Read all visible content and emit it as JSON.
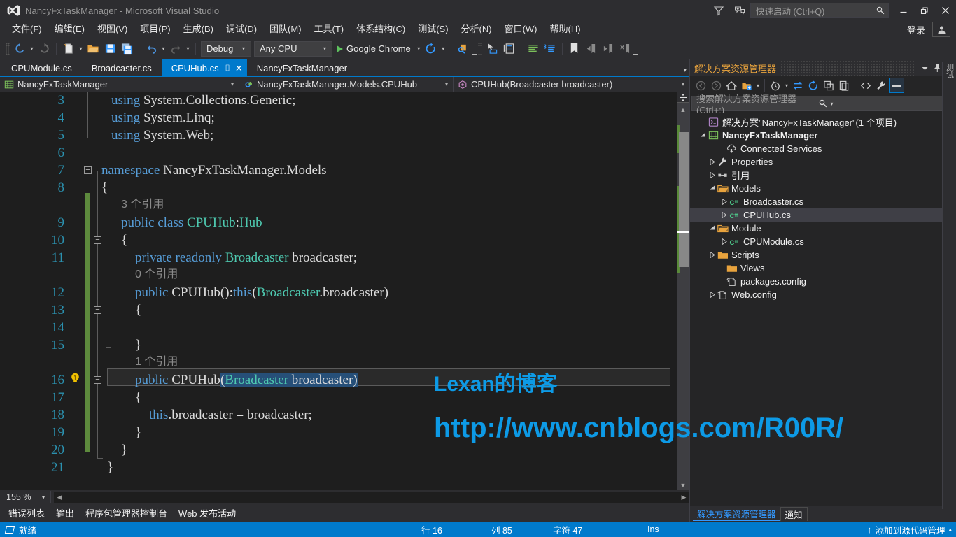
{
  "window": {
    "title": "NancyFxTaskManager - Microsoft Visual Studio",
    "logo_icon": "visual-studio-logo",
    "feedback_icon": "feedback-icon",
    "notify_icon": "notification-icon",
    "minimize_icon": "minimize-icon",
    "restore_icon": "restore-icon",
    "close_icon": "close-icon",
    "quick_launch": {
      "placeholder": "快速启动 (Ctrl+Q)",
      "value": "",
      "search_icon": "search-icon"
    },
    "sign_in": "登录",
    "account_icon": "account-icon"
  },
  "menu": {
    "items": [
      {
        "label": "文件(F)"
      },
      {
        "label": "编辑(E)"
      },
      {
        "label": "视图(V)"
      },
      {
        "label": "项目(P)"
      },
      {
        "label": "生成(B)"
      },
      {
        "label": "调试(D)"
      },
      {
        "label": "团队(M)"
      },
      {
        "label": "工具(T)"
      },
      {
        "label": "体系结构(C)"
      },
      {
        "label": "测试(S)"
      },
      {
        "label": "分析(N)"
      },
      {
        "label": "窗口(W)"
      },
      {
        "label": "帮助(H)"
      }
    ]
  },
  "toolbar": {
    "back_icon": "navigate-back-icon",
    "forward_icon": "navigate-forward-icon",
    "new_item_icon": "new-item-icon",
    "open_file_icon": "open-file-icon",
    "save_icon": "save-icon",
    "save_all_icon": "save-all-icon",
    "undo_icon": "undo-icon",
    "redo_icon": "redo-icon",
    "config_combo": {
      "value": "Debug",
      "caret": "▾"
    },
    "platform_combo": {
      "value": "Any CPU",
      "caret": "▾"
    },
    "run_label": "Google Chrome",
    "run_caret": "▾",
    "refresh_icon": "browser-refresh-icon",
    "find_icon": "find-in-files-icon",
    "navigate_icon": "navigate-to-icon",
    "properties_icon": "properties-window-icon",
    "comment_icon": "comment-selection-icon",
    "uncomment_icon": "uncomment-selection-icon",
    "bookmark_icon": "toggle-bookmark-icon",
    "prev_bookmark_icon": "previous-bookmark-icon",
    "next_bookmark_icon": "next-bookmark-icon",
    "clear_bookmark_icon": "clear-bookmarks-icon",
    "overflow_icon": "toolbar-overflow-icon"
  },
  "tabs": {
    "items": [
      {
        "label": "CPUModule.cs",
        "active": false
      },
      {
        "label": "Broadcaster.cs",
        "active": false
      },
      {
        "label": "CPUHub.cs",
        "active": true,
        "pin_icon": "pin-icon",
        "close_icon": "close-icon"
      },
      {
        "label": "NancyFxTaskManager",
        "active": false
      }
    ],
    "scroll_icon": "tab-overflow-icon"
  },
  "navbar": {
    "project": {
      "label": "NancyFxTaskManager",
      "icon": "project-icon",
      "caret": "▾"
    },
    "type": {
      "label": "NancyFxTaskManager.Models.CPUHub",
      "icon": "class-icon",
      "caret": "▾"
    },
    "member": {
      "label": "CPUHub(Broadcaster broadcaster)",
      "icon": "method-icon",
      "caret": "▾"
    }
  },
  "code": {
    "lightbulb_icon": "quick-actions-lightbulb-icon",
    "lines": [
      {
        "n": "3",
        "indent": 1,
        "tokens": [
          {
            "t": "using ",
            "c": "k"
          },
          {
            "t": "System.Collections.Generic;",
            "c": "p"
          }
        ]
      },
      {
        "n": "4",
        "indent": 1,
        "tokens": [
          {
            "t": "using ",
            "c": "k"
          },
          {
            "t": "System.Linq;",
            "c": "p"
          }
        ]
      },
      {
        "n": "5",
        "indent": 1,
        "tokens": [
          {
            "t": "using ",
            "c": "k"
          },
          {
            "t": "System.Web;",
            "c": "p"
          }
        ]
      },
      {
        "n": "6",
        "indent": 1,
        "tokens": []
      },
      {
        "n": "7",
        "indent": 1,
        "tokens": [
          {
            "t": "namespace ",
            "c": "k"
          },
          {
            "t": "NancyFxTaskManager.Models",
            "c": "p"
          }
        ]
      },
      {
        "n": "8",
        "indent": 1,
        "tokens": [
          {
            "t": "{",
            "c": "p"
          }
        ]
      },
      {
        "n": "",
        "indent": 2,
        "ref": "3 个引用"
      },
      {
        "n": "9",
        "indent": 2,
        "tokens": [
          {
            "t": "public class ",
            "c": "k"
          },
          {
            "t": "CPUHub",
            "c": "t"
          },
          {
            "t": ":",
            "c": "p"
          },
          {
            "t": "Hub",
            "c": "t"
          }
        ]
      },
      {
        "n": "10",
        "indent": 2,
        "tokens": [
          {
            "t": "{",
            "c": "p"
          }
        ]
      },
      {
        "n": "11",
        "indent": 3,
        "tokens": [
          {
            "t": "private readonly ",
            "c": "k"
          },
          {
            "t": "Broadcaster",
            "c": "t"
          },
          {
            "t": " broadcaster;",
            "c": "p"
          }
        ]
      },
      {
        "n": "",
        "indent": 3,
        "ref": "0 个引用"
      },
      {
        "n": "12",
        "indent": 3,
        "tokens": [
          {
            "t": "public ",
            "c": "k"
          },
          {
            "t": "CPUHub():",
            "c": "p"
          },
          {
            "t": "this",
            "c": "k"
          },
          {
            "t": "(",
            "c": "p"
          },
          {
            "t": "Broadcaster",
            "c": "t"
          },
          {
            "t": ".broadcaster)",
            "c": "p"
          }
        ]
      },
      {
        "n": "13",
        "indent": 3,
        "tokens": [
          {
            "t": "{",
            "c": "p"
          }
        ]
      },
      {
        "n": "14",
        "indent": 3,
        "tokens": []
      },
      {
        "n": "15",
        "indent": 3,
        "tokens": [
          {
            "t": "}",
            "c": "p"
          }
        ]
      },
      {
        "n": "",
        "indent": 3,
        "ref": "1 个引用"
      },
      {
        "n": "16",
        "indent": 3,
        "current": true,
        "tokens": [
          {
            "t": "public ",
            "c": "k"
          },
          {
            "t": "CPUHub",
            "c": "p"
          },
          {
            "t": "(",
            "c": "sel"
          },
          {
            "t": "Broadcaster",
            "c": "t sel"
          },
          {
            "t": " broadcaster",
            "c": "p sel"
          },
          {
            "t": ")",
            "c": "sel"
          }
        ]
      },
      {
        "n": "17",
        "indent": 3,
        "tokens": [
          {
            "t": "{",
            "c": "p"
          }
        ]
      },
      {
        "n": "18",
        "indent": 4,
        "tokens": [
          {
            "t": "this",
            "c": "k"
          },
          {
            "t": ".broadcaster = broadcaster;",
            "c": "p"
          }
        ]
      },
      {
        "n": "19",
        "indent": 3,
        "tokens": [
          {
            "t": "}",
            "c": "p"
          }
        ]
      },
      {
        "n": "20",
        "indent": 2,
        "tokens": [
          {
            "t": "}",
            "c": "p"
          }
        ]
      },
      {
        "n": "21",
        "indent": 1,
        "tokens": [
          {
            "t": "}",
            "c": "p"
          }
        ]
      }
    ],
    "zoom": "155 %",
    "zoom_caret": "▾",
    "split_icon": "split-view-icon",
    "scroll_up_icon": "scroll-up-icon",
    "scroll_down_icon": "scroll-down-icon",
    "hscroll_left_icon": "scroll-left-icon",
    "hscroll_right_icon": "scroll-right-icon"
  },
  "dock_tabs": [
    {
      "label": "错误列表"
    },
    {
      "label": "输出"
    },
    {
      "label": "程序包管理器控制台"
    },
    {
      "label": "Web 发布活动"
    }
  ],
  "solution_explorer": {
    "title": "解决方案资源管理器",
    "header_icons": [
      {
        "name": "dropdown-icon",
        "glyph": "▾"
      },
      {
        "name": "pin-icon",
        "glyph": "⚲"
      },
      {
        "name": "close-icon",
        "glyph": "✕"
      }
    ],
    "toolbar_icons": [
      {
        "name": "back-icon"
      },
      {
        "name": "forward-icon"
      },
      {
        "name": "home-icon"
      },
      {
        "name": "pending-changes-icon"
      },
      {
        "name": "dropdown-caret-icon"
      },
      {
        "name": "view-history-icon"
      },
      {
        "name": "dropdown-caret-icon"
      },
      {
        "name": "sync-icon"
      },
      {
        "name": "refresh-icon"
      },
      {
        "name": "collapse-all-icon"
      },
      {
        "name": "show-all-files-icon"
      },
      {
        "name": "view-code-icon"
      },
      {
        "name": "properties-icon"
      },
      {
        "name": "preview-selected-items-icon"
      }
    ],
    "search": {
      "placeholder": "搜索解决方案资源管理器(Ctrl+;)",
      "value": "",
      "search_icon": "search-icon",
      "caret": "▾"
    },
    "tree": [
      {
        "depth": 0,
        "expander": "",
        "icon": "solution-icon",
        "label": "解决方案\"NancyFxTaskManager\"(1 个项目)",
        "bold": false,
        "selected": false
      },
      {
        "depth": 0,
        "expander": "▲",
        "icon": "web-project-icon",
        "label": "NancyFxTaskManager",
        "bold": true,
        "selected": false
      },
      {
        "depth": 1,
        "expander": "",
        "icon": "connected-services-icon",
        "label": "Connected Services",
        "bold": false,
        "selected": false
      },
      {
        "depth": 1,
        "expander": "▷",
        "icon": "properties-wrench-icon",
        "label": "Properties",
        "bold": false,
        "selected": false
      },
      {
        "depth": 1,
        "expander": "▷",
        "icon": "references-icon",
        "label": "引用",
        "bold": false,
        "selected": false
      },
      {
        "depth": 1,
        "expander": "▲",
        "icon": "folder-open-icon",
        "label": "Models",
        "bold": false,
        "selected": false
      },
      {
        "depth": 2,
        "expander": "▷",
        "icon": "csharp-file-icon",
        "label": "Broadcaster.cs",
        "bold": false,
        "selected": false
      },
      {
        "depth": 2,
        "expander": "▷",
        "icon": "csharp-file-icon",
        "label": "CPUHub.cs",
        "bold": false,
        "selected": true
      },
      {
        "depth": 1,
        "expander": "▲",
        "icon": "folder-open-icon",
        "label": "Module",
        "bold": false,
        "selected": false
      },
      {
        "depth": 2,
        "expander": "▷",
        "icon": "csharp-file-icon",
        "label": "CPUModule.cs",
        "bold": false,
        "selected": false
      },
      {
        "depth": 1,
        "expander": "▷",
        "icon": "folder-icon",
        "label": "Scripts",
        "bold": false,
        "selected": false
      },
      {
        "depth": 1,
        "expander": "",
        "icon": "folder-icon",
        "label": "Views",
        "bold": false,
        "selected": false
      },
      {
        "depth": 1,
        "expander": "",
        "icon": "config-file-icon",
        "label": "packages.config",
        "bold": false,
        "selected": false
      },
      {
        "depth": 1,
        "expander": "▷",
        "icon": "config-file-icon",
        "label": "Web.config",
        "bold": false,
        "selected": false
      }
    ],
    "footer_tabs": [
      {
        "label": "解决方案资源管理器",
        "active": true
      },
      {
        "label": "通知",
        "active": false
      }
    ]
  },
  "right_vertical_tab": {
    "label": "测试",
    "icon": "test-explorer-icon"
  },
  "statusbar": {
    "ready": "就绪",
    "ready_icon": "status-ready-icon",
    "line": "行 16",
    "column": "列 85",
    "char": "字符 47",
    "insert_mode": "Ins",
    "source_control": "添加到源代码管理",
    "source_control_icon": "upload-arrow-icon",
    "source_control_caret": "▴"
  },
  "watermark": {
    "line1": "Lexan的博客",
    "line2": "http://www.cnblogs.com/R00R/",
    "color": "#0d9ae6"
  }
}
